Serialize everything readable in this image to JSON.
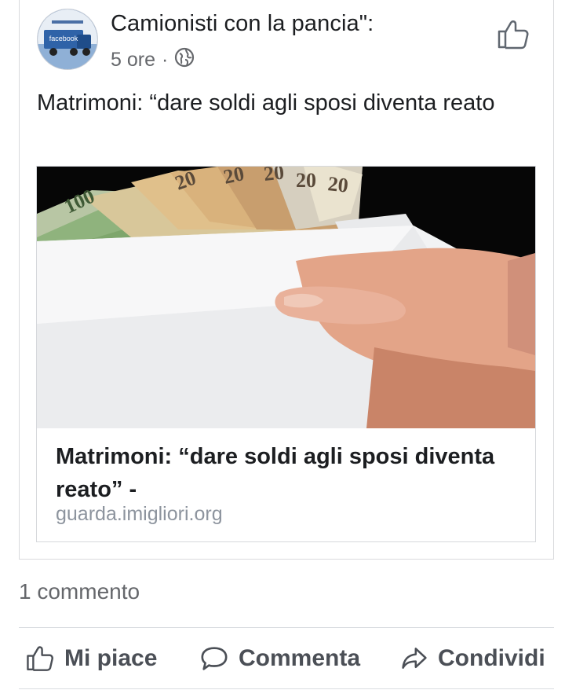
{
  "post": {
    "page_name": "Camionisti con la pancia\":",
    "time": "5 ore",
    "separator": "·",
    "privacy_icon": "globe-icon",
    "text": "Matrimoni: “dare soldi agli sposi diventa reato",
    "avatar_text": "facebook"
  },
  "link": {
    "title": "Matrimoni: “dare soldi agli sposi diventa reato” -",
    "domain": "guarda.imigliori.org"
  },
  "stats": {
    "comments": "1 commento"
  },
  "actions": {
    "like": "Mi piace",
    "comment": "Commenta",
    "share": "Condividi"
  }
}
